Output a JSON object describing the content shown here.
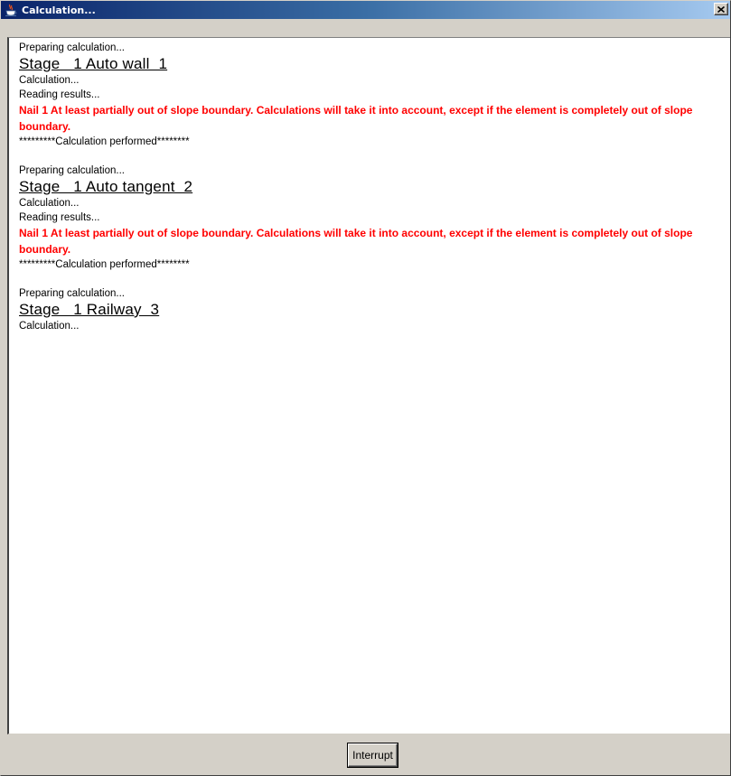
{
  "window": {
    "title": "Calculation...",
    "title_icon": "java-cup-icon",
    "close_icon": "close-icon",
    "close_glyph": "✕"
  },
  "log": {
    "sections": [
      {
        "preparing": "Preparing calculation...",
        "stage_title": "Stage   1 Auto wall  1",
        "calculation": "Calculation...",
        "reading": "Reading results...",
        "warning": "Nail 1 At least partially out of slope boundary. Calculations will take it into account, except if the element is completely out of slope boundary.",
        "performed": "*********Calculation performed********"
      },
      {
        "preparing": "Preparing calculation...",
        "stage_title": "Stage   1 Auto tangent  2",
        "calculation": "Calculation...",
        "reading": "Reading results...",
        "warning": "Nail 1 At least partially out of slope boundary. Calculations will take it into account, except if the element is completely out of slope boundary.",
        "performed": "*********Calculation performed********"
      },
      {
        "preparing": "Preparing calculation...",
        "stage_title": "Stage   1 Railway  3",
        "calculation": "Calculation..."
      }
    ]
  },
  "buttons": {
    "interrupt_label": "Interrupt"
  },
  "colors": {
    "title_bar_start": "#0a246a",
    "title_bar_end": "#a6caf0",
    "warning_text": "#ff0000",
    "dialog_background": "#d4d0c8"
  }
}
